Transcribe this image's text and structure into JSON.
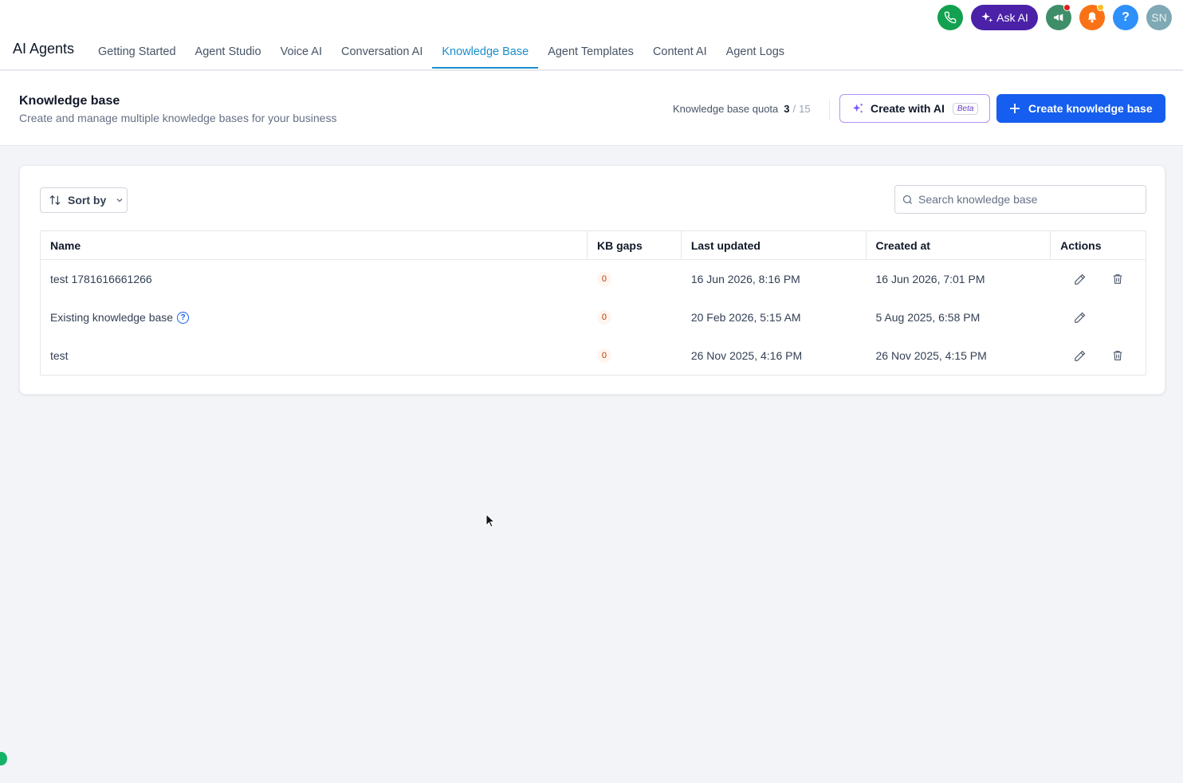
{
  "header": {
    "app_title": "AI Agents",
    "ask_ai_label": "Ask AI",
    "help_glyph": "?",
    "avatar_initials": "SN",
    "icons": [
      "phone-icon",
      "sparkle-icon",
      "megaphone-icon",
      "bell-icon",
      "help-icon"
    ],
    "nav_tabs": [
      {
        "label": "Getting Started",
        "active": false
      },
      {
        "label": "Agent Studio",
        "active": false
      },
      {
        "label": "Voice AI",
        "active": false
      },
      {
        "label": "Conversation AI",
        "active": false
      },
      {
        "label": "Knowledge Base",
        "active": true
      },
      {
        "label": "Agent Templates",
        "active": false
      },
      {
        "label": "Content AI",
        "active": false
      },
      {
        "label": "Agent Logs",
        "active": false
      }
    ]
  },
  "page": {
    "title": "Knowledge base",
    "subtitle": "Create and manage multiple knowledge bases for your business",
    "quota_label": "Knowledge base quota",
    "quota_used": "3",
    "quota_sep": "/",
    "quota_total": "15",
    "create_ai_label": "Create with AI",
    "beta_label": "Beta",
    "create_label": "Create knowledge base"
  },
  "toolbar": {
    "sort_label": "Sort by",
    "search_placeholder": "Search knowledge base"
  },
  "table": {
    "columns": [
      "Name",
      "KB gaps",
      "Last updated",
      "Created at",
      "Actions"
    ],
    "rows": [
      {
        "name": "test 1781616661266",
        "gaps": "0",
        "updated": "16 Jun 2026, 8:16 PM",
        "created": "16 Jun 2026, 7:01 PM",
        "has_help": false,
        "deletable": true
      },
      {
        "name": "Existing knowledge base",
        "gaps": "0",
        "updated": "20 Feb 2026, 5:15 AM",
        "created": "5 Aug 2025, 6:58 PM",
        "has_help": true,
        "deletable": false
      },
      {
        "name": "test",
        "gaps": "0",
        "updated": "26 Nov 2025, 4:16 PM",
        "created": "26 Nov 2025, 4:15 PM",
        "has_help": false,
        "deletable": true
      }
    ]
  },
  "colors": {
    "accent": "#155eef",
    "active_tab": "#1a8fcb",
    "ask_ai": "#4b21a8",
    "phone": "#12a150",
    "bell": "#f97316"
  }
}
